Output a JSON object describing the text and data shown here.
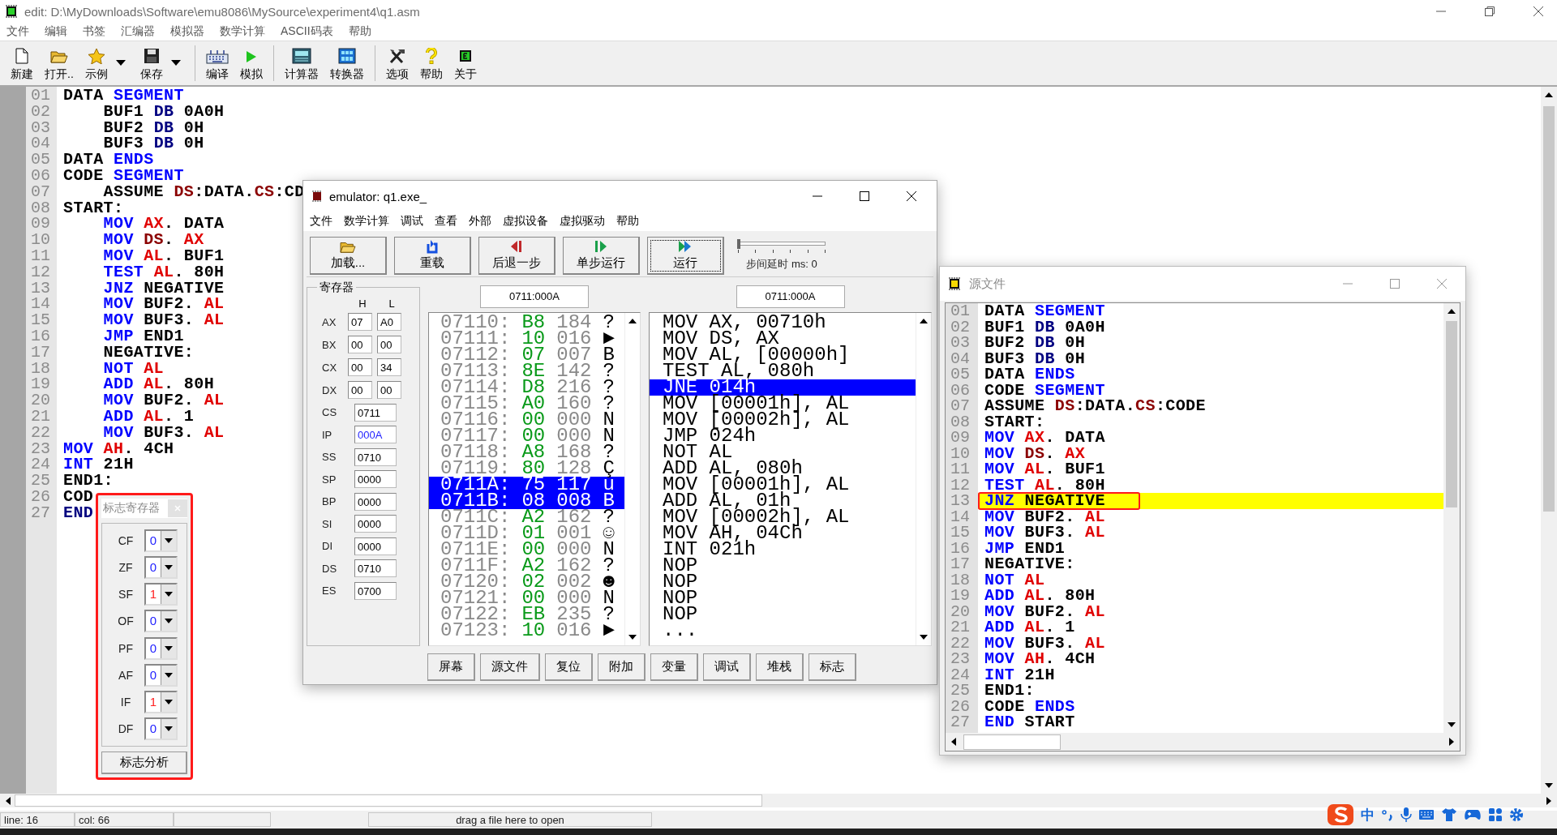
{
  "editor_window": {
    "title": "edit: D:\\MyDownloads\\Software\\emu8086\\MySource\\experiment4\\q1.asm",
    "menu": [
      "文件",
      "编辑",
      "书签",
      "汇编器",
      "模拟器",
      "数学计算",
      "ASCII码表",
      "帮助"
    ],
    "toolbar": [
      {
        "buttons": [
          {
            "label": "新建",
            "dropdown": false
          },
          {
            "label": "打开..",
            "dropdown": false
          },
          {
            "label": "示例",
            "dropdown": true
          },
          {
            "label": "保存",
            "dropdown": true
          }
        ]
      },
      {
        "buttons": [
          {
            "label": "编译",
            "dropdown": false
          },
          {
            "label": "模拟",
            "dropdown": false
          }
        ]
      },
      {
        "buttons": [
          {
            "label": "计算器",
            "dropdown": false
          },
          {
            "label": "转换器",
            "dropdown": false
          }
        ]
      },
      {
        "buttons": [
          {
            "label": "选项",
            "dropdown": false
          },
          {
            "label": "帮助",
            "dropdown": false
          },
          {
            "label": "关于",
            "dropdown": false
          }
        ]
      }
    ],
    "code_lines": [
      {
        "number": "01",
        "tokens": [
          {
            "text": "DATA ",
            "kind": "plain"
          },
          {
            "text": "SEGMENT",
            "kind": "keyword"
          }
        ]
      },
      {
        "number": "02",
        "tokens": [
          {
            "text": "    BUF1 ",
            "kind": "plain"
          },
          {
            "text": "DB",
            "kind": "directive"
          },
          {
            "text": " 0A0H",
            "kind": "plain"
          }
        ]
      },
      {
        "number": "03",
        "tokens": [
          {
            "text": "    BUF2 ",
            "kind": "plain"
          },
          {
            "text": "DB",
            "kind": "directive"
          },
          {
            "text": " 0H",
            "kind": "plain"
          }
        ]
      },
      {
        "number": "04",
        "tokens": [
          {
            "text": "    BUF3 ",
            "kind": "plain"
          },
          {
            "text": "DB",
            "kind": "directive"
          },
          {
            "text": " 0H",
            "kind": "plain"
          }
        ]
      },
      {
        "number": "05",
        "tokens": [
          {
            "text": "DATA ",
            "kind": "plain"
          },
          {
            "text": "ENDS",
            "kind": "keyword"
          }
        ]
      },
      {
        "number": "06",
        "tokens": [
          {
            "text": "CODE ",
            "kind": "plain"
          },
          {
            "text": "SEGMENT",
            "kind": "keyword"
          }
        ]
      },
      {
        "number": "07",
        "tokens": [
          {
            "text": "    ASSUME ",
            "kind": "plain"
          },
          {
            "text": "DS",
            "kind": "segreg"
          },
          {
            "text": ":DATA.",
            "kind": "plain"
          },
          {
            "text": "CS",
            "kind": "segreg"
          },
          {
            "text": ":CD",
            "kind": "plain"
          }
        ]
      },
      {
        "number": "08",
        "tokens": [
          {
            "text": "START:",
            "kind": "plain"
          }
        ]
      },
      {
        "number": "09",
        "tokens": [
          {
            "text": "    MOV ",
            "kind": "keyword"
          },
          {
            "text": "AX",
            "kind": "register"
          },
          {
            "text": ". DATA",
            "kind": "plain"
          }
        ]
      },
      {
        "number": "10",
        "tokens": [
          {
            "text": "    MOV ",
            "kind": "keyword"
          },
          {
            "text": "DS",
            "kind": "segreg"
          },
          {
            "text": ". ",
            "kind": "plain"
          },
          {
            "text": "AX",
            "kind": "register"
          }
        ]
      },
      {
        "number": "11",
        "tokens": [
          {
            "text": "    MOV ",
            "kind": "keyword"
          },
          {
            "text": "AL",
            "kind": "register"
          },
          {
            "text": ". BUF1",
            "kind": "plain"
          }
        ]
      },
      {
        "number": "12",
        "tokens": [
          {
            "text": "    TEST ",
            "kind": "keyword"
          },
          {
            "text": "AL",
            "kind": "register"
          },
          {
            "text": ". 80H",
            "kind": "plain"
          }
        ]
      },
      {
        "number": "13",
        "tokens": [
          {
            "text": "    JNZ ",
            "kind": "keyword"
          },
          {
            "text": "NEGATIVE",
            "kind": "plain"
          }
        ]
      },
      {
        "number": "14",
        "tokens": [
          {
            "text": "    MOV ",
            "kind": "keyword"
          },
          {
            "text": "BUF2. ",
            "kind": "plain"
          },
          {
            "text": "AL",
            "kind": "register"
          }
        ]
      },
      {
        "number": "15",
        "tokens": [
          {
            "text": "    MOV ",
            "kind": "keyword"
          },
          {
            "text": "BUF3. ",
            "kind": "plain"
          },
          {
            "text": "AL",
            "kind": "register"
          }
        ]
      },
      {
        "number": "16",
        "tokens": [
          {
            "text": "    JMP ",
            "kind": "keyword"
          },
          {
            "text": "END1",
            "kind": "plain"
          }
        ]
      },
      {
        "number": "17",
        "tokens": [
          {
            "text": "    NEGATIVE:",
            "kind": "plain"
          }
        ]
      },
      {
        "number": "18",
        "tokens": [
          {
            "text": "    NOT ",
            "kind": "keyword"
          },
          {
            "text": "AL",
            "kind": "register"
          }
        ]
      },
      {
        "number": "19",
        "tokens": [
          {
            "text": "    ADD ",
            "kind": "keyword"
          },
          {
            "text": "AL",
            "kind": "register"
          },
          {
            "text": ". 80H",
            "kind": "plain"
          }
        ]
      },
      {
        "number": "20",
        "tokens": [
          {
            "text": "    MOV ",
            "kind": "keyword"
          },
          {
            "text": "BUF2. ",
            "kind": "plain"
          },
          {
            "text": "AL",
            "kind": "register"
          }
        ]
      },
      {
        "number": "21",
        "tokens": [
          {
            "text": "    ADD ",
            "kind": "keyword"
          },
          {
            "text": "AL",
            "kind": "register"
          },
          {
            "text": ". 1",
            "kind": "plain"
          }
        ]
      },
      {
        "number": "22",
        "tokens": [
          {
            "text": "    MOV ",
            "kind": "keyword"
          },
          {
            "text": "BUF3. ",
            "kind": "plain"
          },
          {
            "text": "AL",
            "kind": "register"
          }
        ]
      },
      {
        "number": "23",
        "tokens": [
          {
            "text": "MOV ",
            "kind": "keyword"
          },
          {
            "text": "AH",
            "kind": "register"
          },
          {
            "text": ". 4CH",
            "kind": "plain"
          }
        ]
      },
      {
        "number": "24",
        "tokens": [
          {
            "text": "INT ",
            "kind": "keyword"
          },
          {
            "text": "21H",
            "kind": "plain"
          }
        ]
      },
      {
        "number": "25",
        "tokens": [
          {
            "text": "END1:",
            "kind": "plain"
          }
        ]
      },
      {
        "number": "26",
        "tokens": [
          {
            "text": "COD",
            "kind": "plain"
          }
        ]
      },
      {
        "number": "27",
        "tokens": [
          {
            "text": "END",
            "kind": "directive"
          }
        ]
      }
    ],
    "status_bar": {
      "line": "line: 16",
      "column": "col: 66",
      "message": "drag a file here to open"
    }
  },
  "emulator_window": {
    "title": "emulator: q1.exe_",
    "menu": [
      "文件",
      "数学计算",
      "调试",
      "查看",
      "外部",
      "虚拟设备",
      "虚拟驱动",
      "帮助"
    ],
    "toolbar": [
      {
        "label": "加载...",
        "focused": false
      },
      {
        "label": "重载",
        "focused": false
      },
      {
        "label": "后退一步",
        "focused": false
      },
      {
        "label": "单步运行",
        "focused": false
      },
      {
        "label": "运行",
        "focused": true
      }
    ],
    "step_delay": {
      "label": "步间延时 ms: 0",
      "level": 0
    },
    "registers": {
      "title": "寄存器",
      "high_header": "H",
      "low_header": "L",
      "byte_registers": [
        {
          "name": "AX",
          "high": "07",
          "low": "A0"
        },
        {
          "name": "BX",
          "high": "00",
          "low": "00"
        },
        {
          "name": "CX",
          "high": "00",
          "low": "34"
        },
        {
          "name": "DX",
          "high": "00",
          "low": "00"
        }
      ],
      "word_registers": [
        {
          "name": "CS",
          "value": "0711",
          "changed": false
        },
        {
          "name": "IP",
          "value": "000A",
          "changed": true
        },
        {
          "name": "SS",
          "value": "0710",
          "changed": false
        },
        {
          "name": "SP",
          "value": "0000",
          "changed": false
        },
        {
          "name": "BP",
          "value": "0000",
          "changed": false
        },
        {
          "name": "SI",
          "value": "0000",
          "changed": false
        },
        {
          "name": "DI",
          "value": "0000",
          "changed": false
        },
        {
          "name": "DS",
          "value": "0710",
          "changed": false
        },
        {
          "name": "ES",
          "value": "0700",
          "changed": false
        }
      ]
    },
    "memory_address": "0711:000A",
    "disassembly_address": "0711:000A",
    "memory": [
      {
        "address": "07110:",
        "hex": "B8",
        "decimal": "184",
        "char": "?",
        "selected": false
      },
      {
        "address": "07111:",
        "hex": "10",
        "decimal": "016",
        "char": "►",
        "selected": false
      },
      {
        "address": "07112:",
        "hex": "07",
        "decimal": "007",
        "char": "B",
        "selected": false
      },
      {
        "address": "07113:",
        "hex": "8E",
        "decimal": "142",
        "char": "?",
        "selected": false
      },
      {
        "address": "07114:",
        "hex": "D8",
        "decimal": "216",
        "char": "?",
        "selected": false
      },
      {
        "address": "07115:",
        "hex": "A0",
        "decimal": "160",
        "char": "?",
        "selected": false
      },
      {
        "address": "07116:",
        "hex": "00",
        "decimal": "000",
        "char": "N",
        "selected": false
      },
      {
        "address": "07117:",
        "hex": "00",
        "decimal": "000",
        "char": "N",
        "selected": false
      },
      {
        "address": "07118:",
        "hex": "A8",
        "decimal": "168",
        "char": "?",
        "selected": false
      },
      {
        "address": "07119:",
        "hex": "80",
        "decimal": "128",
        "char": "Ç",
        "selected": false
      },
      {
        "address": "0711A:",
        "hex": "75",
        "decimal": "117",
        "char": "u",
        "selected": true
      },
      {
        "address": "0711B:",
        "hex": "08",
        "decimal": "008",
        "char": "B",
        "selected": true
      },
      {
        "address": "0711C:",
        "hex": "A2",
        "decimal": "162",
        "char": "?",
        "selected": false
      },
      {
        "address": "0711D:",
        "hex": "01",
        "decimal": "001",
        "char": "☺",
        "selected": false
      },
      {
        "address": "0711E:",
        "hex": "00",
        "decimal": "000",
        "char": "N",
        "selected": false
      },
      {
        "address": "0711F:",
        "hex": "A2",
        "decimal": "162",
        "char": "?",
        "selected": false
      },
      {
        "address": "07120:",
        "hex": "02",
        "decimal": "002",
        "char": "☻",
        "selected": false
      },
      {
        "address": "07121:",
        "hex": "00",
        "decimal": "000",
        "char": "N",
        "selected": false
      },
      {
        "address": "07122:",
        "hex": "EB",
        "decimal": "235",
        "char": "?",
        "selected": false
      },
      {
        "address": "07123:",
        "hex": "10",
        "decimal": "016",
        "char": "►",
        "selected": false
      }
    ],
    "disassembly": [
      {
        "text": "MOV AX, 00710h",
        "selected": false
      },
      {
        "text": "MOV DS, AX",
        "selected": false
      },
      {
        "text": "MOV AL, [00000h]",
        "selected": false
      },
      {
        "text": "TEST AL, 080h",
        "selected": false
      },
      {
        "text": "JNE 014h",
        "selected": true
      },
      {
        "text": "MOV [00001h], AL",
        "selected": false
      },
      {
        "text": "MOV [00002h], AL",
        "selected": false
      },
      {
        "text": "JMP 024h",
        "selected": false
      },
      {
        "text": "NOT AL",
        "selected": false
      },
      {
        "text": "ADD AL, 080h",
        "selected": false
      },
      {
        "text": "MOV [00001h], AL",
        "selected": false
      },
      {
        "text": "ADD AL, 01h",
        "selected": false
      },
      {
        "text": "MOV [00002h], AL",
        "selected": false
      },
      {
        "text": "MOV AH, 04Ch",
        "selected": false
      },
      {
        "text": "INT 021h",
        "selected": false
      },
      {
        "text": "NOP",
        "selected": false
      },
      {
        "text": "NOP",
        "selected": false
      },
      {
        "text": "NOP",
        "selected": false
      },
      {
        "text": "NOP",
        "selected": false
      },
      {
        "text": "...",
        "selected": false
      }
    ],
    "bottom_buttons": [
      "屏幕",
      "源文件",
      "复位",
      "附加",
      "变量",
      "调试",
      "堆栈",
      "标志"
    ]
  },
  "source_window": {
    "title": "源文件",
    "lines": [
      {
        "number": "01",
        "highlighted": false,
        "tokens": [
          {
            "text": "DATA ",
            "kind": "plain"
          },
          {
            "text": "SEGMENT",
            "kind": "keyword"
          }
        ]
      },
      {
        "number": "02",
        "highlighted": false,
        "tokens": [
          {
            "text": "BUF1 ",
            "kind": "plain"
          },
          {
            "text": "DB",
            "kind": "directive"
          },
          {
            "text": " 0A0H",
            "kind": "plain"
          }
        ]
      },
      {
        "number": "03",
        "highlighted": false,
        "tokens": [
          {
            "text": "BUF2 ",
            "kind": "plain"
          },
          {
            "text": "DB",
            "kind": "directive"
          },
          {
            "text": " 0H",
            "kind": "plain"
          }
        ]
      },
      {
        "number": "04",
        "highlighted": false,
        "tokens": [
          {
            "text": "BUF3 ",
            "kind": "plain"
          },
          {
            "text": "DB",
            "kind": "directive"
          },
          {
            "text": " 0H",
            "kind": "plain"
          }
        ]
      },
      {
        "number": "05",
        "highlighted": false,
        "tokens": [
          {
            "text": "DATA ",
            "kind": "plain"
          },
          {
            "text": "ENDS",
            "kind": "keyword"
          }
        ]
      },
      {
        "number": "06",
        "highlighted": false,
        "tokens": [
          {
            "text": "CODE ",
            "kind": "plain"
          },
          {
            "text": "SEGMENT",
            "kind": "keyword"
          }
        ]
      },
      {
        "number": "07",
        "highlighted": false,
        "tokens": [
          {
            "text": "ASSUME ",
            "kind": "plain"
          },
          {
            "text": "DS",
            "kind": "segreg"
          },
          {
            "text": ":DATA.",
            "kind": "plain"
          },
          {
            "text": "CS",
            "kind": "segreg"
          },
          {
            "text": ":CODE",
            "kind": "plain"
          }
        ]
      },
      {
        "number": "08",
        "highlighted": false,
        "tokens": [
          {
            "text": "START:",
            "kind": "plain"
          }
        ]
      },
      {
        "number": "09",
        "highlighted": false,
        "tokens": [
          {
            "text": "MOV ",
            "kind": "keyword"
          },
          {
            "text": "AX",
            "kind": "register"
          },
          {
            "text": ". DATA",
            "kind": "plain"
          }
        ]
      },
      {
        "number": "10",
        "highlighted": false,
        "tokens": [
          {
            "text": "MOV ",
            "kind": "keyword"
          },
          {
            "text": "DS",
            "kind": "segreg"
          },
          {
            "text": ". ",
            "kind": "plain"
          },
          {
            "text": "AX",
            "kind": "register"
          }
        ]
      },
      {
        "number": "11",
        "highlighted": false,
        "tokens": [
          {
            "text": "MOV ",
            "kind": "keyword"
          },
          {
            "text": "AL",
            "kind": "register"
          },
          {
            "text": ". BUF1",
            "kind": "plain"
          }
        ]
      },
      {
        "number": "12",
        "highlighted": false,
        "tokens": [
          {
            "text": "TEST ",
            "kind": "keyword"
          },
          {
            "text": "AL",
            "kind": "register"
          },
          {
            "text": ". 80H",
            "kind": "plain"
          }
        ]
      },
      {
        "number": "13",
        "highlighted": true,
        "tokens": [
          {
            "text": "JNZ ",
            "kind": "keyword"
          },
          {
            "text": "NEGATIVE",
            "kind": "plain"
          }
        ]
      },
      {
        "number": "14",
        "highlighted": false,
        "tokens": [
          {
            "text": "MOV ",
            "kind": "keyword"
          },
          {
            "text": "BUF2. ",
            "kind": "plain"
          },
          {
            "text": "AL",
            "kind": "register"
          }
        ]
      },
      {
        "number": "15",
        "highlighted": false,
        "tokens": [
          {
            "text": "MOV ",
            "kind": "keyword"
          },
          {
            "text": "BUF3. ",
            "kind": "plain"
          },
          {
            "text": "AL",
            "kind": "register"
          }
        ]
      },
      {
        "number": "16",
        "highlighted": false,
        "tokens": [
          {
            "text": "JMP ",
            "kind": "keyword"
          },
          {
            "text": "END1",
            "kind": "plain"
          }
        ]
      },
      {
        "number": "17",
        "highlighted": false,
        "tokens": [
          {
            "text": "NEGATIVE:",
            "kind": "plain"
          }
        ]
      },
      {
        "number": "18",
        "highlighted": false,
        "tokens": [
          {
            "text": "NOT ",
            "kind": "keyword"
          },
          {
            "text": "AL",
            "kind": "register"
          }
        ]
      },
      {
        "number": "19",
        "highlighted": false,
        "tokens": [
          {
            "text": "ADD ",
            "kind": "keyword"
          },
          {
            "text": "AL",
            "kind": "register"
          },
          {
            "text": ". 80H",
            "kind": "plain"
          }
        ]
      },
      {
        "number": "20",
        "highlighted": false,
        "tokens": [
          {
            "text": "MOV ",
            "kind": "keyword"
          },
          {
            "text": "BUF2. ",
            "kind": "plain"
          },
          {
            "text": "AL",
            "kind": "register"
          }
        ]
      },
      {
        "number": "21",
        "highlighted": false,
        "tokens": [
          {
            "text": "ADD ",
            "kind": "keyword"
          },
          {
            "text": "AL",
            "kind": "register"
          },
          {
            "text": ". 1",
            "kind": "plain"
          }
        ]
      },
      {
        "number": "22",
        "highlighted": false,
        "tokens": [
          {
            "text": "MOV ",
            "kind": "keyword"
          },
          {
            "text": "BUF3. ",
            "kind": "plain"
          },
          {
            "text": "AL",
            "kind": "register"
          }
        ]
      },
      {
        "number": "23",
        "highlighted": false,
        "tokens": [
          {
            "text": "MOV ",
            "kind": "keyword"
          },
          {
            "text": "AH",
            "kind": "register"
          },
          {
            "text": ". 4CH",
            "kind": "plain"
          }
        ]
      },
      {
        "number": "24",
        "highlighted": false,
        "tokens": [
          {
            "text": "INT ",
            "kind": "keyword"
          },
          {
            "text": "21H",
            "kind": "plain"
          }
        ]
      },
      {
        "number": "25",
        "highlighted": false,
        "tokens": [
          {
            "text": "END1:",
            "kind": "plain"
          }
        ]
      },
      {
        "number": "26",
        "highlighted": false,
        "tokens": [
          {
            "text": "CODE ",
            "kind": "plain"
          },
          {
            "text": "ENDS",
            "kind": "keyword"
          }
        ]
      },
      {
        "number": "27",
        "highlighted": false,
        "tokens": [
          {
            "text": "END ",
            "kind": "keyword"
          },
          {
            "text": "START",
            "kind": "plain"
          }
        ]
      }
    ]
  },
  "flags_window": {
    "title": "标志寄存器",
    "flags": [
      {
        "name": "CF",
        "value": "0",
        "set": false
      },
      {
        "name": "ZF",
        "value": "0",
        "set": false
      },
      {
        "name": "SF",
        "value": "1",
        "set": true
      },
      {
        "name": "OF",
        "value": "0",
        "set": false
      },
      {
        "name": "PF",
        "value": "0",
        "set": false
      },
      {
        "name": "AF",
        "value": "0",
        "set": false
      },
      {
        "name": "IF",
        "value": "1",
        "set": true
      },
      {
        "name": "DF",
        "value": "0",
        "set": false
      }
    ],
    "analyze_button": "标志分析"
  },
  "ime_toolbar": {
    "mode": "中"
  }
}
